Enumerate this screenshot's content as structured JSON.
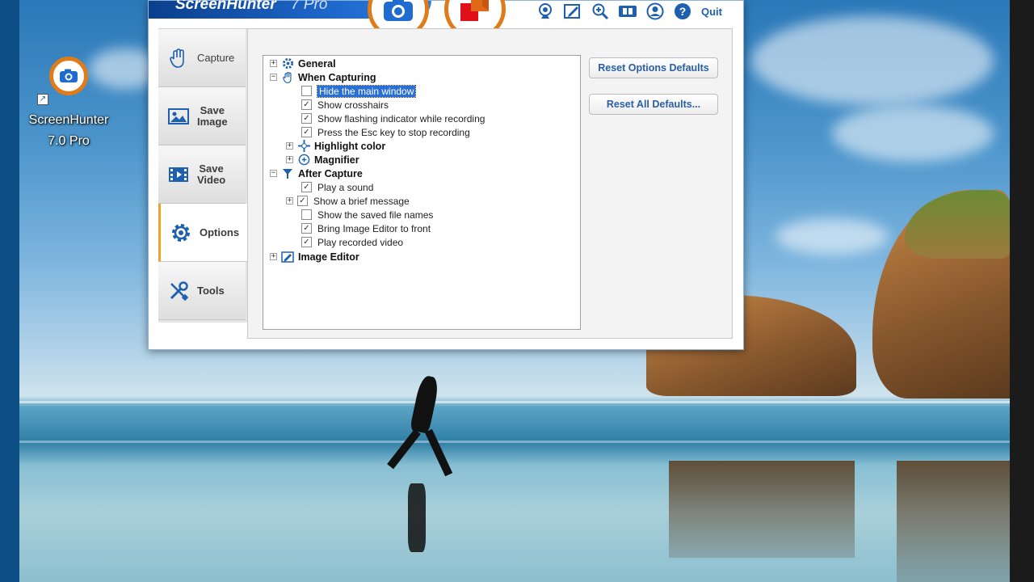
{
  "app": {
    "brand": "ScreenHunter",
    "edition": "7 Pro",
    "quit_label": "Quit",
    "accent": "#e07b1a",
    "title_blue": "#1f6bd0",
    "toolbar_icons": [
      "webcam-icon",
      "edit-icon",
      "zoom-icon",
      "film-icon",
      "user-icon",
      "help-icon"
    ]
  },
  "desktop": {
    "shortcut_label_line1": "ScreenHunter",
    "shortcut_label_line2": "7.0 Pro"
  },
  "sidebar": {
    "items": [
      {
        "label": "Capture",
        "icon": "hand-icon"
      },
      {
        "label": "Save\nImage",
        "icon": "image-icon"
      },
      {
        "label": "Save\nVideo",
        "icon": "video-icon"
      },
      {
        "label": "Options",
        "icon": "gear-icon",
        "active": true
      },
      {
        "label": "Tools",
        "icon": "tools-icon"
      }
    ]
  },
  "options": {
    "reset_options_label": "Reset Options Defaults",
    "reset_all_label": "Reset All Defaults...",
    "tree": {
      "general": "General",
      "when_capturing": "When Capturing",
      "hide_main_window": "Hide the main window",
      "show_crosshairs": "Show crosshairs",
      "show_flashing": "Show flashing indicator while recording",
      "press_esc": "Press the Esc key to stop recording",
      "highlight_color": "Highlight color",
      "magnifier": "Magnifier",
      "after_capture": "After Capture",
      "play_sound": "Play a sound",
      "show_brief_message": "Show a brief message",
      "show_saved_names": "Show the saved file names",
      "bring_image_editor": "Bring Image Editor to front",
      "play_recorded_video": "Play recorded video",
      "image_editor": "Image Editor"
    },
    "checked": {
      "hide_main_window": false,
      "show_crosshairs": true,
      "show_flashing": true,
      "press_esc": true,
      "play_sound": true,
      "show_brief_message": true,
      "show_saved_names": false,
      "bring_image_editor": true,
      "play_recorded_video": true
    }
  }
}
